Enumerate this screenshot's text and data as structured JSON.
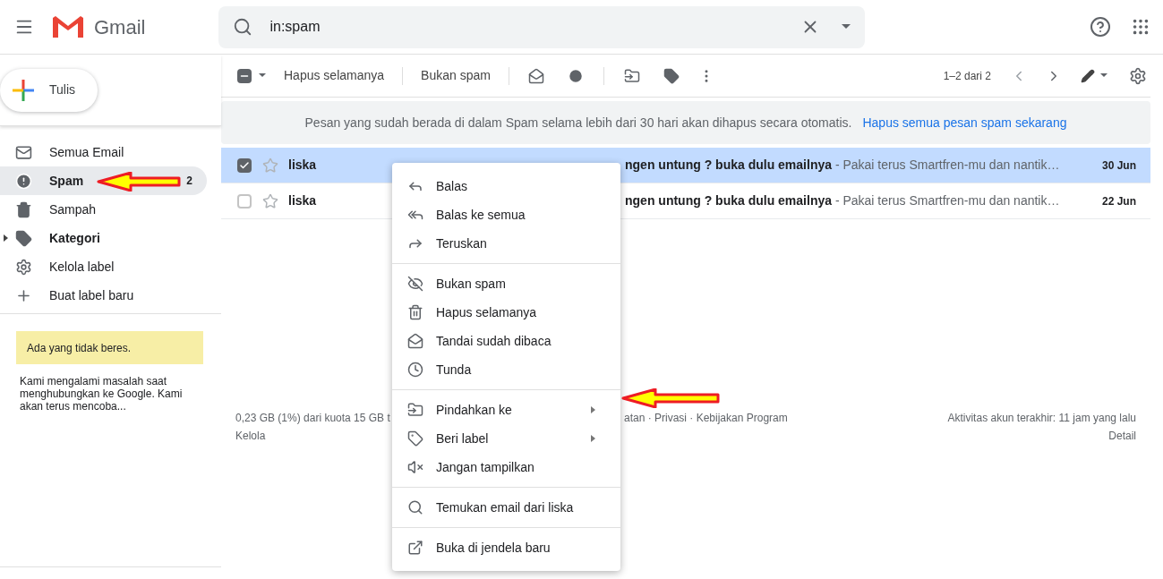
{
  "header": {
    "app_name": "Gmail",
    "search": {
      "value": "in:spam"
    }
  },
  "compose": {
    "label": "Tulis"
  },
  "sidebar": {
    "items": [
      {
        "label": "Semua Email",
        "selected": false,
        "bold": false,
        "expandable": false
      },
      {
        "label": "Spam",
        "selected": true,
        "bold": true,
        "expandable": false,
        "count": "2"
      },
      {
        "label": "Sampah",
        "selected": false,
        "bold": false,
        "expandable": false
      },
      {
        "label": "Kategori",
        "selected": false,
        "bold": true,
        "expandable": true
      },
      {
        "label": "Kelola label",
        "selected": false,
        "bold": false,
        "expandable": false
      },
      {
        "label": "Buat label baru",
        "selected": false,
        "bold": false,
        "expandable": false
      }
    ],
    "warning": "Ada yang tidak beres.",
    "message": "Kami mengalami masalah saat menghubungkan ke Google. Kami akan terus mencoba..."
  },
  "toolbar": {
    "select_all_indeterminate": true,
    "buttons": [
      "Hapus selamanya",
      "Bukan spam"
    ],
    "pagination": "1–2 dari 2"
  },
  "banner": {
    "text": "Pesan yang sudah berada di dalam Spam selama lebih dari 30 hari akan dihapus secara otomatis.",
    "link": "Hapus semua pesan spam sekarang"
  },
  "rows": [
    {
      "selected": true,
      "checked": true,
      "starred": false,
      "sender": "liska",
      "subject": "ngen untung ? buka dulu emailnya",
      "snippet": " - Pakai terus Smartfren-mu dan nantik…",
      "date": "30 Jun"
    },
    {
      "selected": false,
      "checked": false,
      "starred": false,
      "sender": "liska",
      "subject": "ngen untung ? buka dulu emailnya",
      "snippet": " - Pakai terus Smartfren-mu dan nantik…",
      "date": "22 Jun"
    }
  ],
  "footer": {
    "storage": "0,23 GB (1%) dari kuota 15 GB t",
    "manage": "Kelola",
    "links": "atan · Privasi · Kebijakan Program",
    "activity": "Aktivitas akun terakhir: 11 jam yang lalu",
    "details": "Detail"
  },
  "context_menu": {
    "groups": [
      [
        {
          "label": "Balas",
          "submenu": false
        },
        {
          "label": "Balas ke semua",
          "submenu": false
        },
        {
          "label": "Teruskan",
          "submenu": false
        }
      ],
      [
        {
          "label": "Bukan spam",
          "submenu": false
        },
        {
          "label": "Hapus selamanya",
          "submenu": false
        },
        {
          "label": "Tandai sudah dibaca",
          "submenu": false
        },
        {
          "label": "Tunda",
          "submenu": false
        }
      ],
      [
        {
          "label": "Pindahkan ke",
          "submenu": true
        },
        {
          "label": "Beri label",
          "submenu": true
        },
        {
          "label": "Jangan tampilkan",
          "submenu": false
        }
      ],
      [
        {
          "label": "Temukan email dari liska",
          "submenu": false
        }
      ],
      [
        {
          "label": "Buka di jendela baru",
          "submenu": false
        }
      ]
    ]
  }
}
